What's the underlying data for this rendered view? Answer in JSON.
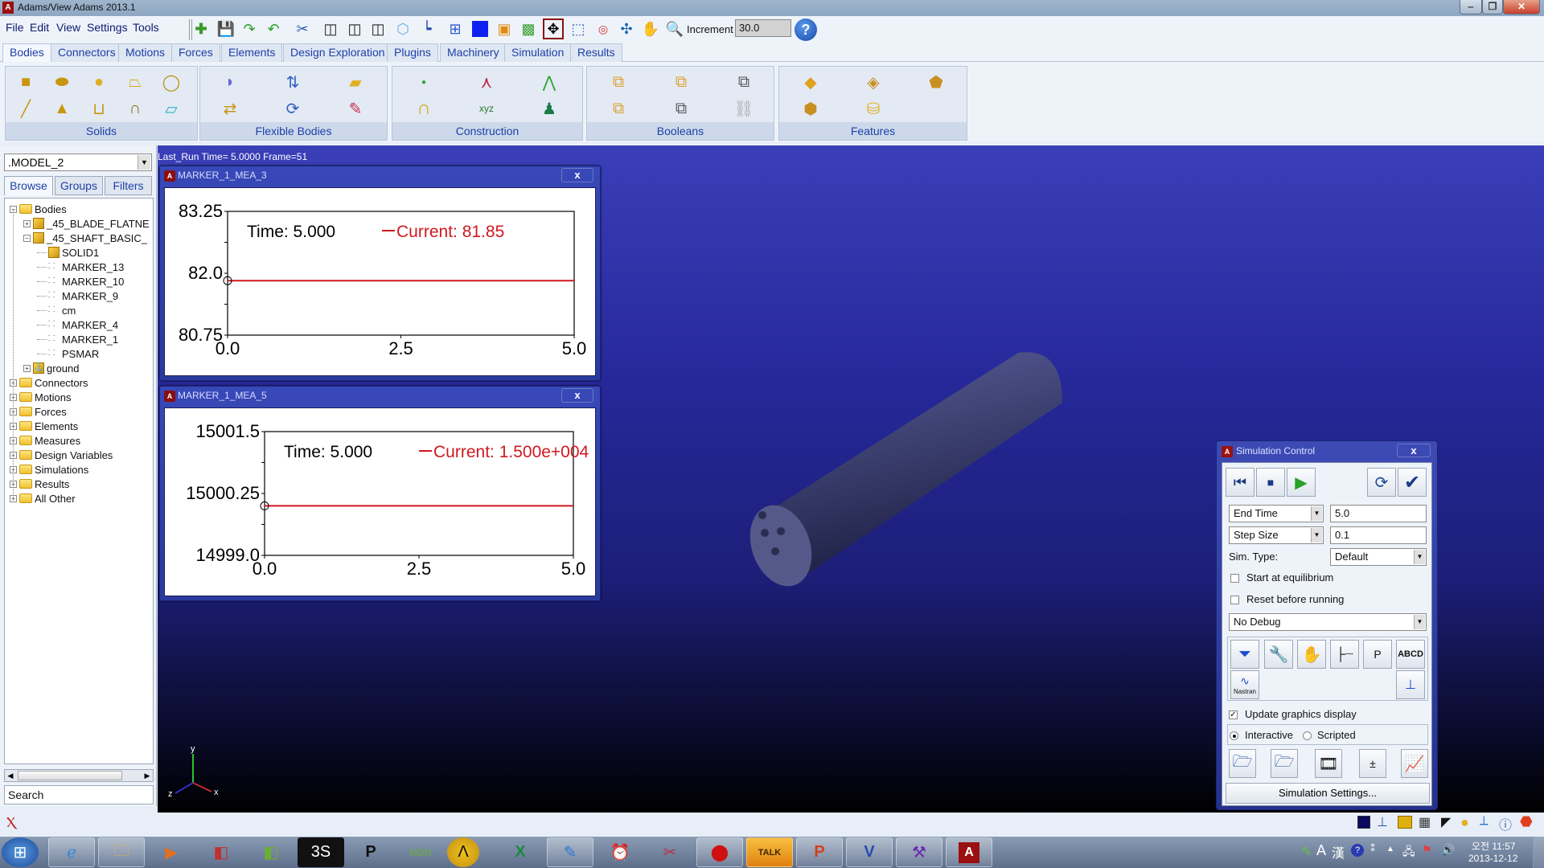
{
  "window": {
    "title": "Adams/View Adams 2013.1",
    "app_icon_letter": "A",
    "minimize": "‒",
    "maximize": "❐",
    "close": "✕"
  },
  "menu": {
    "items": [
      "File",
      "Edit",
      "View",
      "Settings",
      "Tools"
    ]
  },
  "toolbar": {
    "increment_label": "Increment",
    "increment_value": "30.0",
    "help": "?"
  },
  "ribbon_tabs": [
    "Bodies",
    "Connectors",
    "Motions",
    "Forces",
    "Elements",
    "Design Exploration",
    "Plugins",
    "Machinery",
    "Simulation",
    "Results"
  ],
  "ribbon_groups": [
    {
      "label": "Solids"
    },
    {
      "label": "Flexible Bodies"
    },
    {
      "label": "Construction"
    },
    {
      "label": "Booleans"
    },
    {
      "label": "Features"
    }
  ],
  "browser": {
    "model": ".MODEL_2",
    "tabs": [
      "Browse",
      "Groups",
      "Filters"
    ],
    "tree": [
      {
        "label": "Bodies",
        "expand": "−",
        "type": "folder"
      },
      {
        "label": "_45_BLADE_FLATNE",
        "expand": "+",
        "type": "body"
      },
      {
        "label": "_45_SHAFT_BASIC_",
        "expand": "−",
        "type": "body"
      },
      {
        "label": "SOLID1",
        "type": "solid"
      },
      {
        "label": "MARKER_13",
        "type": "marker"
      },
      {
        "label": "MARKER_10",
        "type": "marker"
      },
      {
        "label": "MARKER_9",
        "type": "marker"
      },
      {
        "label": "cm",
        "type": "marker"
      },
      {
        "label": "MARKER_4",
        "type": "marker"
      },
      {
        "label": "MARKER_1",
        "type": "marker"
      },
      {
        "label": "PSMAR",
        "type": "marker"
      },
      {
        "label": "ground",
        "expand": "+",
        "type": "ground"
      },
      {
        "label": "Connectors",
        "expand": "+",
        "type": "folder"
      },
      {
        "label": "Motions",
        "expand": "+",
        "type": "folder"
      },
      {
        "label": "Forces",
        "expand": "+",
        "type": "folder"
      },
      {
        "label": "Elements",
        "expand": "+",
        "type": "folder"
      },
      {
        "label": "Measures",
        "expand": "+",
        "type": "folder"
      },
      {
        "label": "Design Variables",
        "expand": "+",
        "type": "folder"
      },
      {
        "label": "Simulations",
        "expand": "+",
        "type": "folder"
      },
      {
        "label": "Results",
        "expand": "+",
        "type": "folder"
      },
      {
        "label": "All Other",
        "expand": "+",
        "type": "folder"
      }
    ],
    "search_placeholder": "Search"
  },
  "viewport": {
    "run_label": "Last_Run   Time=  5.0000  Frame=51",
    "triad": {
      "x": "x",
      "y": "y",
      "z": "z"
    }
  },
  "plots": [
    {
      "title": "MARKER_1_MEA_3",
      "close": "x",
      "time_label": "Time:  5.000",
      "current_label": "Current:  81.85",
      "yticks": [
        "83.25",
        "82.0",
        "80.75"
      ],
      "xticks": [
        "0.0",
        "2.5",
        "5.0"
      ]
    },
    {
      "title": "MARKER_1_MEA_5",
      "close": "x",
      "time_label": "Time:  5.000",
      "current_label": "Current:  1.500e+004",
      "yticks": [
        "15001.5",
        "15000.25",
        "14999.0"
      ],
      "xticks": [
        "0.0",
        "2.5",
        "5.0"
      ]
    }
  ],
  "chart_data": [
    {
      "type": "line",
      "title": "MARKER_1_MEA_3",
      "xlim": [
        0.0,
        5.0
      ],
      "ylim": [
        80.75,
        83.25
      ],
      "x": [
        0.0,
        5.0
      ],
      "series": [
        {
          "name": "Current",
          "values": [
            81.85,
            81.85
          ],
          "color": "#d01820"
        }
      ],
      "xticks": [
        "0.0",
        "2.5",
        "5.0"
      ],
      "yticks": [
        "80.75",
        "82.0",
        "83.25"
      ],
      "annotations": [
        "Time:  5.000",
        "Current:  81.85"
      ]
    },
    {
      "type": "line",
      "title": "MARKER_1_MEA_5",
      "xlim": [
        0.0,
        5.0
      ],
      "ylim": [
        14999.0,
        15001.5
      ],
      "x": [
        0.0,
        5.0
      ],
      "series": [
        {
          "name": "Current",
          "values": [
            15000.0,
            15000.0
          ],
          "color": "#d01820"
        }
      ],
      "xticks": [
        "0.0",
        "2.5",
        "5.0"
      ],
      "yticks": [
        "14999.0",
        "15000.25",
        "15001.5"
      ],
      "annotations": [
        "Time:  5.000",
        "Current:  1.500e+004"
      ]
    }
  ],
  "simulation_control": {
    "title": "Simulation Control",
    "close": "x",
    "end_time_mode": "End Time",
    "end_time_value": "5.0",
    "step_mode": "Step Size",
    "step_value": "0.1",
    "sim_type_label": "Sim. Type:",
    "sim_type_value": "Default",
    "start_equilibrium": "Start at equilibrium",
    "reset_before": "Reset before running",
    "debug": "No Debug",
    "nastran_label": "Nastran",
    "update_graphics": "Update graphics display",
    "update_graphics_checked": true,
    "interactive": "Interactive",
    "scripted": "Scripted",
    "mode_selected": "Interactive",
    "settings_button": "Simulation Settings..."
  },
  "taskbar": {
    "clock_time": "오전 11:57",
    "clock_date": "2013-12-12",
    "ime_a": "A",
    "ime_han": "漢"
  },
  "colors": {
    "accent_tab": "#1e3fa8",
    "plot_line": "#d01820",
    "viewport_top": "#3a3fb8",
    "viewport_bottom": "#000000"
  }
}
